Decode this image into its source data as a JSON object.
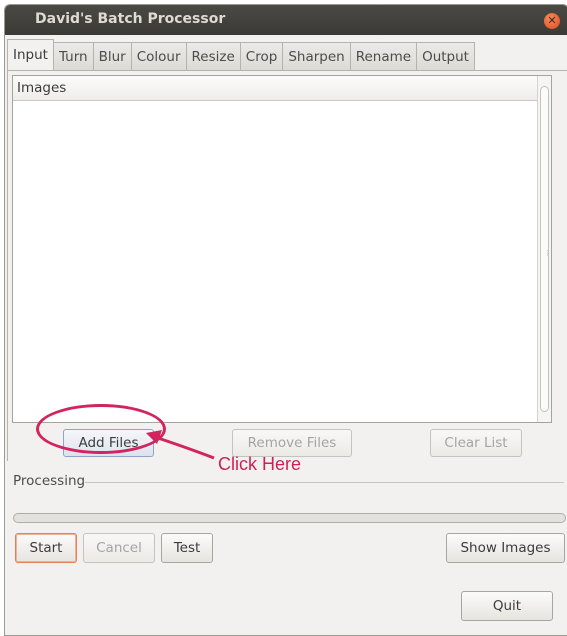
{
  "window": {
    "title": "David's Batch Processor"
  },
  "tabs": [
    {
      "label": "Input",
      "active": true
    },
    {
      "label": "Turn"
    },
    {
      "label": "Blur"
    },
    {
      "label": "Colour"
    },
    {
      "label": "Resize"
    },
    {
      "label": "Crop"
    },
    {
      "label": "Sharpen"
    },
    {
      "label": "Rename"
    },
    {
      "label": "Output"
    }
  ],
  "input": {
    "list_header": "Images",
    "add_files": "Add Files",
    "remove_files": "Remove Files",
    "clear_list": "Clear List"
  },
  "processing": {
    "label": "Processing",
    "progress": 0
  },
  "bottom": {
    "start": "Start",
    "cancel": "Cancel",
    "test": "Test",
    "show_images": "Show Images",
    "quit": "Quit"
  },
  "annotation": {
    "text": "Click Here",
    "color": "#d2245f"
  },
  "icons": {
    "close": "close-icon"
  }
}
